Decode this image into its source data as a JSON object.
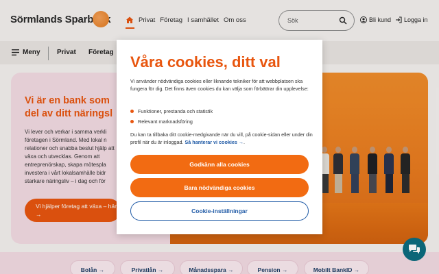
{
  "brand": {
    "name": "Sörmlands Sparbank",
    "accent": "#e8560f",
    "link": "#1f5aa6"
  },
  "topnav": {
    "items": [
      "Privat",
      "Företag",
      "I samhället",
      "Om oss"
    ]
  },
  "search": {
    "placeholder": "Sök"
  },
  "account": {
    "my_bank": "Bli kund",
    "login": "Logga in"
  },
  "subnav": {
    "menu_label": "Meny",
    "items": [
      "Privat",
      "Företag"
    ]
  },
  "hero": {
    "title": "Vi är en bank som del av ditt näringsl",
    "body": "Vi lever och verkar i samma verkli företagen i Sörmland. Med lokal n relationer och snabba beslut hjälp att växa och utvecklas. Genom att entreprenörskap, skapa mötespla investera i vårt lokalsamhälle bidr starkare näringsliv – i dag och för",
    "cta": "Vi hjälper företag att växa – här"
  },
  "quick_links": [
    "Bolån",
    "Privatlån",
    "Månadsspara",
    "Pension",
    "Mobilt BankID"
  ],
  "cookie_modal": {
    "title": "Våra cookies, ditt val",
    "intro": "Vi använder nödvändiga cookies eller liknande tekniker för att webbplatsen ska fungera för dig. Det finns även cookies du kan välja som förbättrar din upplevelse:",
    "list": [
      "Funktioner, prestanda och statistik",
      "Relevant marknadsföring"
    ],
    "text2": "Du kan ta tillbaka ditt cookie-medgivande när du vill, på cookie-sidan eller under din profil när du är inloggad.",
    "manage_link": "Så hanterar vi cookies",
    "accept_all": "Godkänn alla cookies",
    "only_necessary": "Bara nödvändiga cookies",
    "settings": "Cookie-inställningar"
  },
  "icons": {
    "home": "home-icon",
    "search": "search-icon",
    "user": "user-icon",
    "login": "login-icon",
    "menu": "hamburger-icon",
    "chat": "chat-icon",
    "arrow": "arrow-right-icon"
  }
}
